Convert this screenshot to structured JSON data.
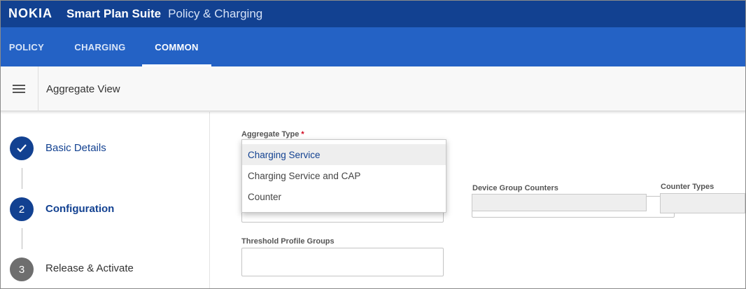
{
  "header": {
    "logo": "NOKIA",
    "product": "Smart Plan Suite",
    "module": "Policy & Charging"
  },
  "tabs": [
    {
      "label": "POLICY",
      "active": false
    },
    {
      "label": "CHARGING",
      "active": false
    },
    {
      "label": "COMMON",
      "active": true
    }
  ],
  "view": {
    "menu_icon": "hamburger-menu-icon",
    "title": "Aggregate View"
  },
  "steps": [
    {
      "label": "Basic Details",
      "number": "",
      "icon": "checkmark-icon",
      "state": "completed"
    },
    {
      "label": "Configuration",
      "number": "2",
      "state": "active"
    },
    {
      "label": "Release & Activate",
      "number": "3",
      "state": "pending"
    }
  ],
  "form": {
    "aggregate_type": {
      "label": "Aggregate Type",
      "required_marker": "*",
      "options": [
        "Charging Service",
        "Charging Service and CAP",
        "Counter"
      ],
      "highlighted": "Charging Service"
    },
    "device_group_counters": {
      "label": "Device Group Counters",
      "value": ""
    },
    "counter_types": {
      "label": "Counter Types",
      "value": ""
    },
    "threshold_profile_groups": {
      "label": "Threshold Profile Groups",
      "value": ""
    }
  },
  "colors": {
    "topbar": "#124191",
    "tabbar": "#2462c5",
    "step_completed": "#124191",
    "step_pending": "#6e6e6e",
    "required": "#d0021b"
  }
}
